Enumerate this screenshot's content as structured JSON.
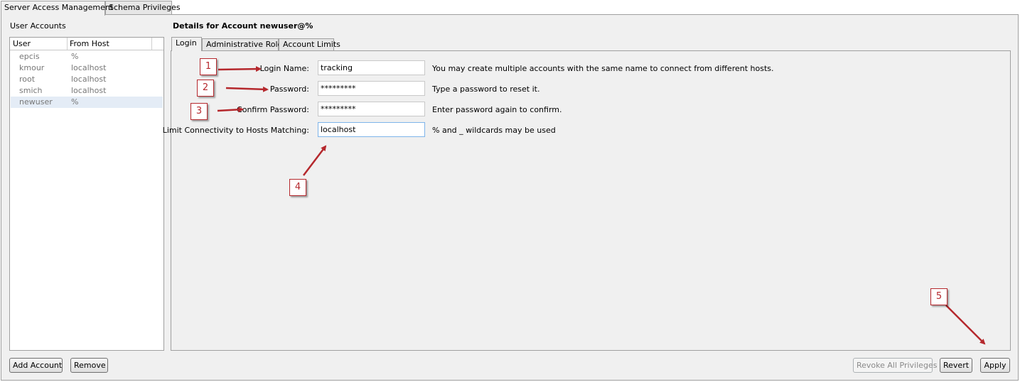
{
  "top_tabs": [
    "Server Access Management",
    "Schema Privileges"
  ],
  "accounts": {
    "title": "User Accounts",
    "columns": [
      "User",
      "From Host"
    ],
    "rows": [
      {
        "user": "epcis",
        "host": "%"
      },
      {
        "user": "kmour",
        "host": "localhost"
      },
      {
        "user": "root",
        "host": "localhost"
      },
      {
        "user": "smich",
        "host": "localhost"
      },
      {
        "user": "newuser",
        "host": "%"
      }
    ],
    "add_label": "Add Account",
    "remove_label": "Remove"
  },
  "details": {
    "title": "Details for Account newuser@%",
    "tabs": [
      "Login",
      "Administrative Roles",
      "Account Limits"
    ],
    "login": {
      "login_name_label": "Login Name:",
      "login_name_value": "tracking",
      "login_name_hint": "You may create multiple accounts with the same name to connect from different hosts.",
      "password_label": "Password:",
      "password_value": "*********",
      "password_hint": "Type a password to reset it.",
      "confirm_label": "Confirm Password:",
      "confirm_value": "*********",
      "confirm_hint": "Enter password again to confirm.",
      "limit_label": "Limit Connectivity to Hosts Matching:",
      "limit_value": "localhost",
      "limit_hint": "% and _ wildcards may be used"
    }
  },
  "footer": {
    "revoke_label": "Revoke All Privileges",
    "revert_label": "Revert",
    "apply_label": "Apply"
  },
  "callouts": [
    "1",
    "2",
    "3",
    "4",
    "5"
  ],
  "colors": {
    "annotation": "#b5282d",
    "panel_bg": "#f0f0f0",
    "selected_row": "#e4ecf6"
  }
}
